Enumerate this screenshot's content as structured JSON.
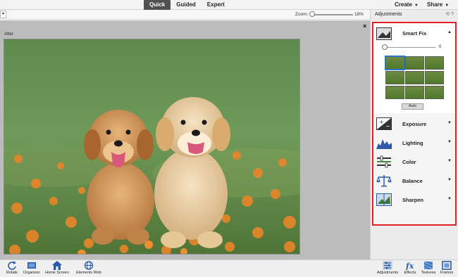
{
  "modes": [
    {
      "label": "Quick",
      "active": true
    },
    {
      "label": "Guided",
      "active": false
    },
    {
      "label": "Expert",
      "active": false
    }
  ],
  "top_right": {
    "create": "Create",
    "share": "Share"
  },
  "zoom": {
    "label": "Zoom:",
    "value": "18%"
  },
  "canvas": {
    "view_label": "After",
    "photo_subject": "two golden retriever puppies in a field of orange flowers"
  },
  "panel": {
    "title": "Adjustments",
    "smart_fix": {
      "label": "Smart Fix",
      "slider_value": "0",
      "auto_label": "Auto",
      "thumb_count": 9,
      "selected_thumb": 0
    },
    "sections": [
      "Exposure",
      "Lighting",
      "Color",
      "Balance",
      "Sharpen"
    ]
  },
  "bottom_left": [
    "Rotate",
    "Organizer",
    "Home Screen",
    "Elements Web"
  ],
  "bottom_right": [
    "Adjustments",
    "Effects",
    "Textures",
    "Frames"
  ],
  "colors": {
    "accent_highlight": "#e2202a",
    "active_mode_bg": "#505050"
  }
}
